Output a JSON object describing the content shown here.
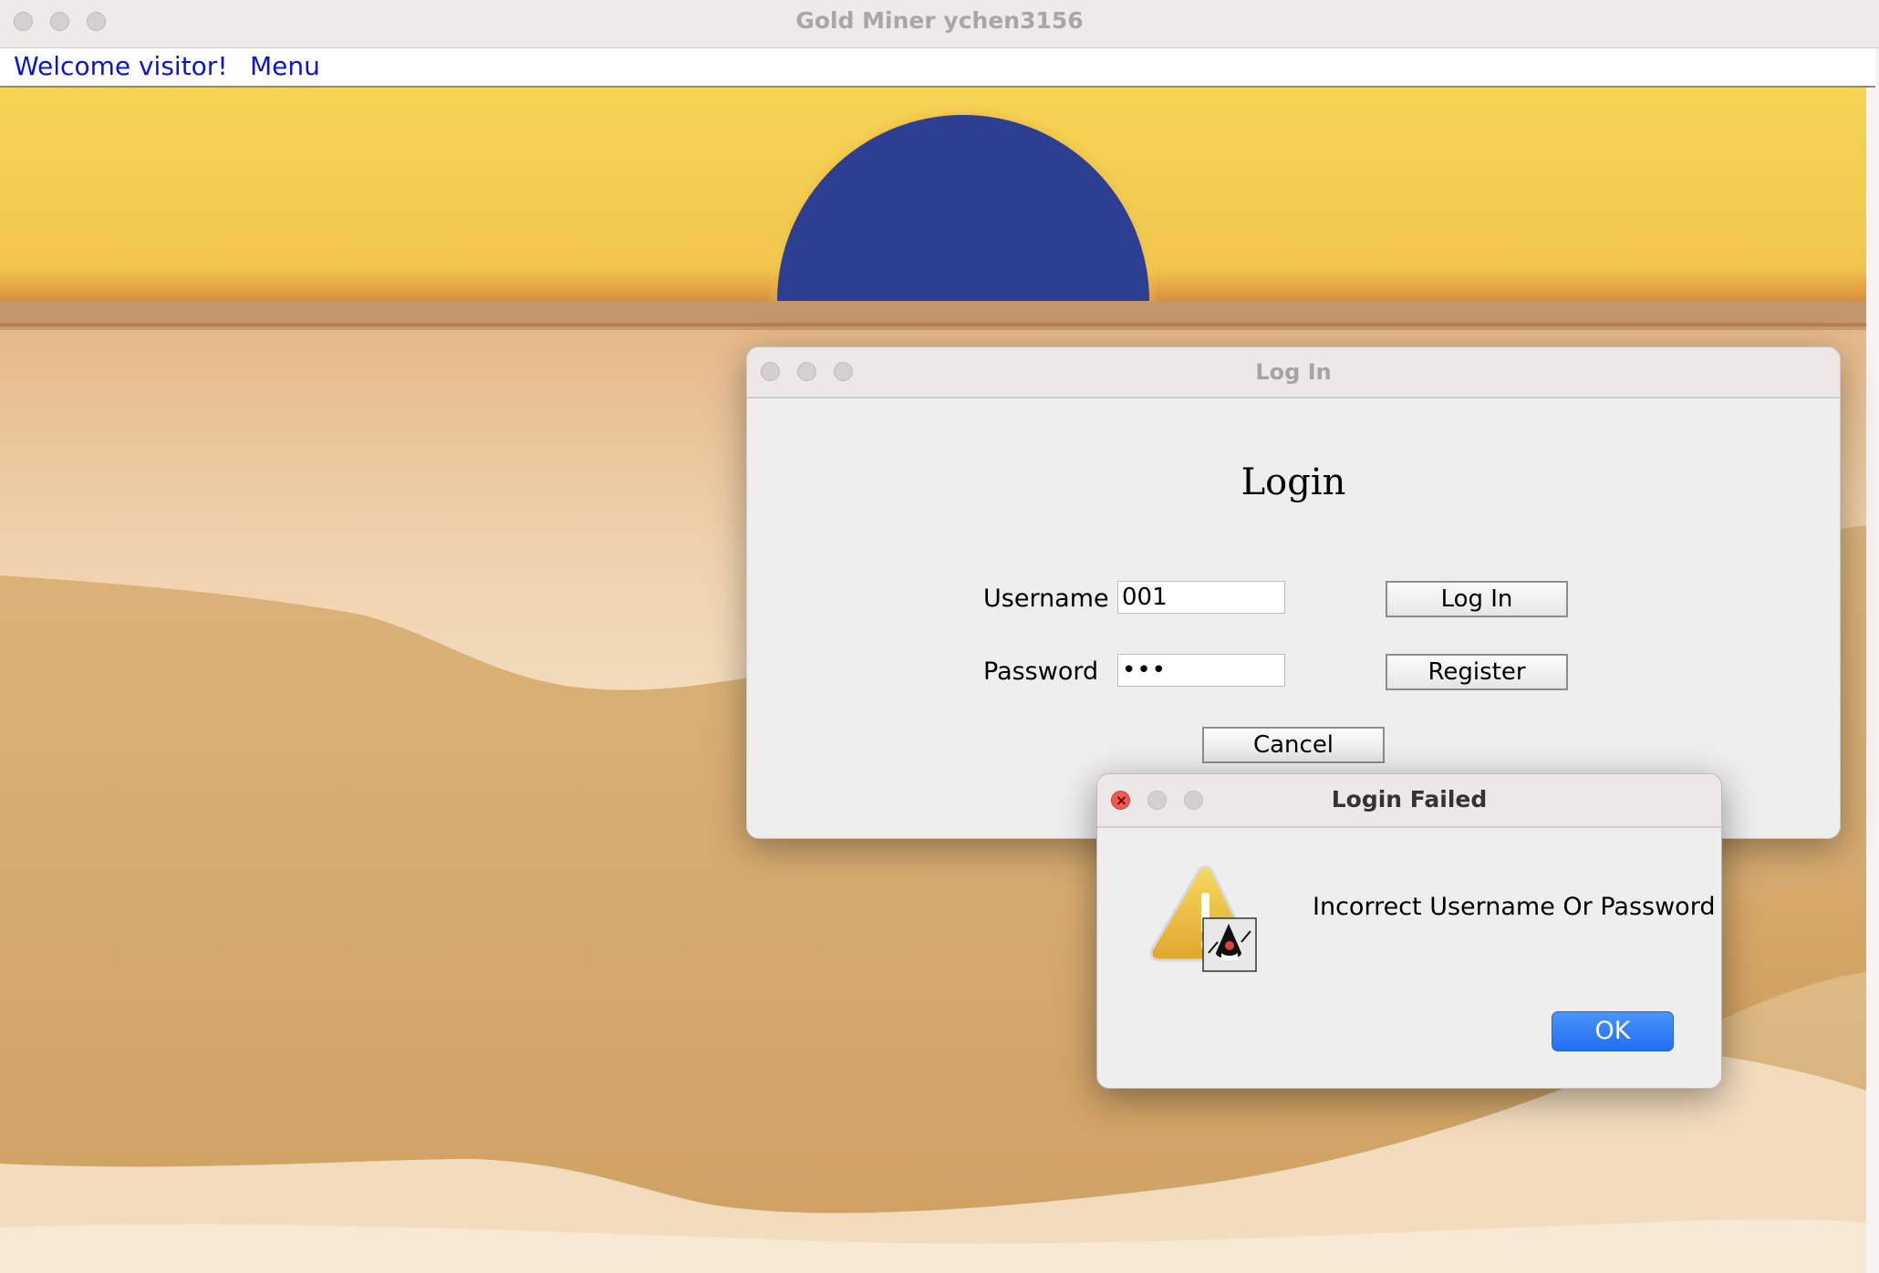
{
  "window": {
    "title": "Gold Miner ychen3156"
  },
  "menubar": {
    "welcome": "Welcome visitor!",
    "menu": "Menu"
  },
  "login_dialog": {
    "title": "Log In",
    "heading": "Login",
    "username_label": "Username",
    "username_value": "001",
    "password_label": "Password",
    "password_value": "•••",
    "login_button": "Log In",
    "register_button": "Register",
    "cancel_button": "Cancel"
  },
  "failed_dialog": {
    "title": "Login Failed",
    "message": "Incorrect Username Or Password",
    "ok_button": "OK",
    "icon": "warning-java-icon"
  },
  "colors": {
    "sky": "#f4d253",
    "sun": "#2d3f93",
    "sand": "#d9ad63",
    "menu_link": "#0a14d8",
    "ok_button": "#2a7af5"
  }
}
